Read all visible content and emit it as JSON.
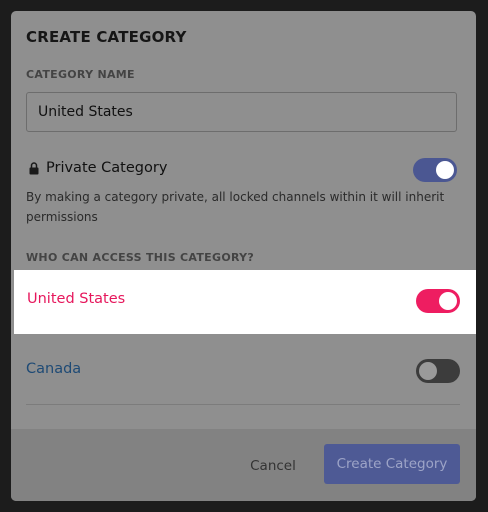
{
  "dialog": {
    "title": "CREATE CATEGORY"
  },
  "category_name": {
    "label": "CATEGORY NAME",
    "value": "United States"
  },
  "private": {
    "label": "Private Category",
    "enabled": true,
    "icon": "lock-icon",
    "description": "By making a category private, all locked channels within it will inherit permissions"
  },
  "access": {
    "label": "WHO CAN ACCESS THIS CATEGORY?",
    "roles": [
      {
        "name": "United States",
        "enabled": true,
        "color": "#e6175c"
      },
      {
        "name": "Canada",
        "enabled": false,
        "color": "#1e4a75"
      }
    ]
  },
  "footer": {
    "cancel_label": "Cancel",
    "create_label": "Create Category"
  },
  "colors": {
    "accent": "#4e5a95",
    "toggle_on_red": "#ee1d61",
    "overlay": "#8f8f8f"
  }
}
